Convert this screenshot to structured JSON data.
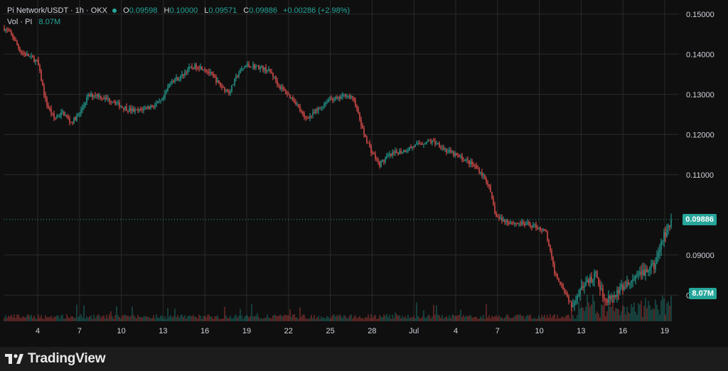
{
  "legend": {
    "symbol": "Pi Network/USDT · 1h · OKX",
    "o_label": "O",
    "o_value": "0.09598",
    "h_label": "H",
    "h_value": "0.10000",
    "l_label": "L",
    "l_value": "0.09571",
    "c_label": "C",
    "c_value": "0.09886",
    "change": "+0.00286 (+2.98%)",
    "vol_label": "Vol · PI",
    "vol_value": "8.07M"
  },
  "price_tag": {
    "value": "0.09886",
    "color": "#26a69a"
  },
  "volume_tag": {
    "value": "8.07M",
    "color": "#26a69a"
  },
  "brand": {
    "name": "TradingView",
    "icon": "tradingview-logo-icon"
  },
  "colors": {
    "up": "#26a69a",
    "down": "#ef5350",
    "background": "#0f0f0f",
    "grid": "#2a2a2a",
    "axis_text": "#d1d4dc"
  },
  "chart_data": {
    "type": "candlestick",
    "y_axis": {
      "ticks": [
        "0.15000",
        "0.14000",
        "0.13000",
        "0.12000",
        "0.11000",
        "0.09000",
        "0.08000"
      ],
      "tick_values": [
        0.15,
        0.14,
        0.13,
        0.12,
        0.11,
        0.09,
        0.08
      ],
      "range": [
        0.0735,
        0.1535
      ]
    },
    "x_axis": {
      "labels": [
        "4",
        "7",
        "10",
        "13",
        "16",
        "19",
        "22",
        "25",
        "28",
        "Jul",
        "4",
        "7",
        "10",
        "13",
        "16",
        "19"
      ]
    },
    "grid": true,
    "last_price": 0.09886,
    "price_path": [
      [
        0,
        0.1465
      ],
      [
        1,
        0.1445
      ],
      [
        2,
        0.1405
      ],
      [
        3,
        0.1395
      ],
      [
        4,
        0.138
      ],
      [
        5,
        0.128
      ],
      [
        6,
        0.124
      ],
      [
        7,
        0.1255
      ],
      [
        8,
        0.123
      ],
      [
        9,
        0.125
      ],
      [
        10,
        0.1295
      ],
      [
        11,
        0.13
      ],
      [
        12,
        0.129
      ],
      [
        13,
        0.1285
      ],
      [
        14,
        0.127
      ],
      [
        15,
        0.1262
      ],
      [
        16,
        0.1258
      ],
      [
        17,
        0.1268
      ],
      [
        18,
        0.1272
      ],
      [
        19,
        0.1285
      ],
      [
        20,
        0.1335
      ],
      [
        21,
        0.134
      ],
      [
        22,
        0.1362
      ],
      [
        23,
        0.137
      ],
      [
        24,
        0.1365
      ],
      [
        25,
        0.1345
      ],
      [
        26,
        0.132
      ],
      [
        27,
        0.1305
      ],
      [
        28,
        0.135
      ],
      [
        29,
        0.1372
      ],
      [
        30,
        0.137
      ],
      [
        31,
        0.1365
      ],
      [
        32,
        0.1355
      ],
      [
        33,
        0.132
      ],
      [
        34,
        0.13
      ],
      [
        35,
        0.128
      ],
      [
        36,
        0.124
      ],
      [
        37,
        0.125
      ],
      [
        38,
        0.1268
      ],
      [
        39,
        0.129
      ],
      [
        40,
        0.1288
      ],
      [
        41,
        0.13
      ],
      [
        42,
        0.1285
      ],
      [
        43,
        0.121
      ],
      [
        44,
        0.116
      ],
      [
        45,
        0.1125
      ],
      [
        46,
        0.1145
      ],
      [
        47,
        0.1155
      ],
      [
        48,
        0.116
      ],
      [
        49,
        0.117
      ],
      [
        50,
        0.1178
      ],
      [
        51,
        0.1183
      ],
      [
        52,
        0.1178
      ],
      [
        53,
        0.116
      ],
      [
        54,
        0.115
      ],
      [
        55,
        0.114
      ],
      [
        56,
        0.1128
      ],
      [
        57,
        0.111
      ],
      [
        58,
        0.108
      ],
      [
        59,
        0.0995
      ],
      [
        60,
        0.0985
      ],
      [
        61,
        0.098
      ],
      [
        62,
        0.0978
      ],
      [
        63,
        0.0975
      ],
      [
        64,
        0.097
      ],
      [
        65,
        0.0955
      ],
      [
        66,
        0.0858
      ],
      [
        67,
        0.082
      ],
      [
        68,
        0.0778
      ],
      [
        69,
        0.081
      ],
      [
        70,
        0.083
      ],
      [
        71,
        0.085
      ],
      [
        72,
        0.079
      ],
      [
        73,
        0.08
      ],
      [
        74,
        0.0815
      ],
      [
        75,
        0.083
      ],
      [
        76,
        0.0845
      ],
      [
        77,
        0.086
      ],
      [
        78,
        0.0872
      ],
      [
        79,
        0.094
      ],
      [
        80,
        0.0989
      ]
    ]
  }
}
